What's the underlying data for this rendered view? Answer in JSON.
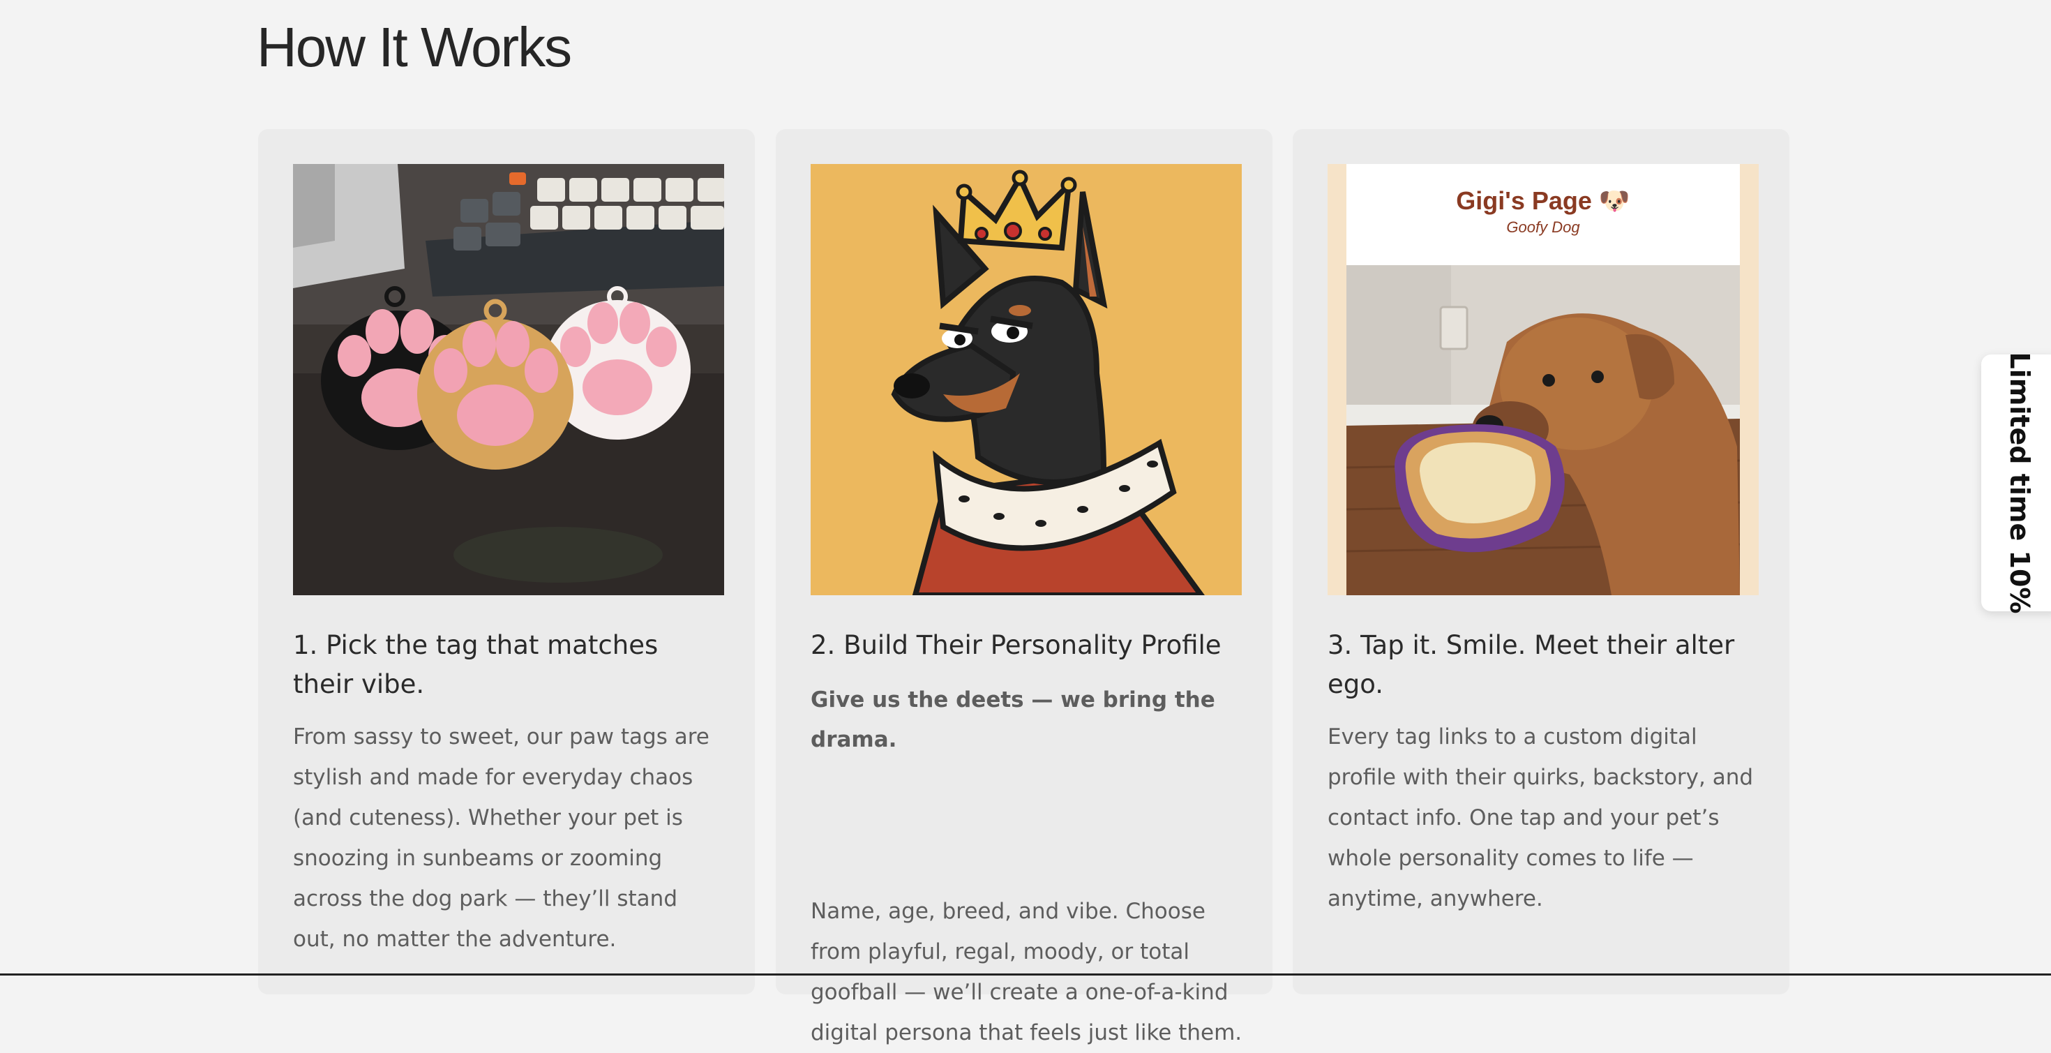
{
  "section": {
    "title": "How It Works"
  },
  "cards": [
    {
      "title": "1. Pick the tag that matches their vibe.",
      "body": "From sassy to sweet, our paw tags are stylish and made for everyday chaos (and cuteness). Whether your pet is snoozing in sunbeams or zooming across the dog park — they’ll stand out, no matter the adventure."
    },
    {
      "title": "2. Build Their Personality Profile",
      "lead": "Give us the deets — we bring the drama.",
      "body": "Name, age, breed, and vibe. Choose from playful, regal, moody, or total goofball — we’ll create a one-of-a-kind digital persona that feels just like them."
    },
    {
      "title": "3. Tap it. Smile. Meet their alter ego.",
      "body": "Every tag links to a custom digital profile with their quirks, backstory, and contact info. One tap and your pet’s whole personality comes to life — anytime, anywhere.",
      "profile_preview": {
        "name": "Gigi's Page 🐶",
        "subtitle": "Goofy Dog"
      }
    }
  ],
  "promo_tab": {
    "label": "Limited time 10%"
  },
  "colors": {
    "page_bg": "#f3f3f3",
    "card_bg": "#ebebeb",
    "portrait_bg": "#ecb85e",
    "preview_name": "#8a3a22"
  },
  "icons": [
    "paw-tag-black",
    "paw-tag-gold",
    "paw-tag-white",
    "crown",
    "doberman",
    "dog-with-toast"
  ]
}
